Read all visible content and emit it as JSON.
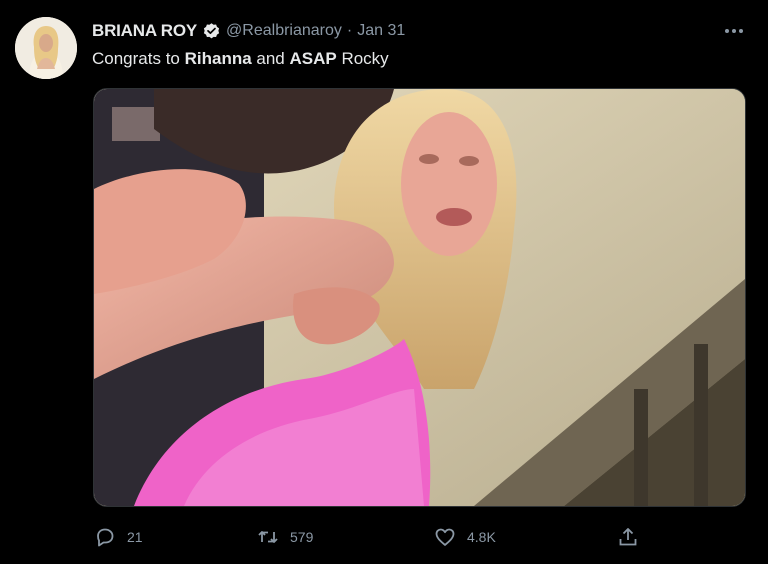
{
  "tweet": {
    "author": {
      "display_name": "BRIANA ROY",
      "handle": "@Realbrianaroy",
      "verified": true,
      "avatar_icon": "avatar-photo"
    },
    "separator": "·",
    "date": "Jan 31",
    "text_parts": {
      "prefix": "Congrats to ",
      "name1": "Rihanna",
      "middle": " and ",
      "name2": "ASAP",
      "suffix": " Rocky"
    },
    "media": {
      "description_icon": "photo-image"
    },
    "actions": {
      "replies": "21",
      "retweets": "579",
      "likes": "4.8K"
    },
    "colors": {
      "background": "#000000",
      "primary_text": "#e7e9ea",
      "secondary_text": "#8b98a5",
      "verified_badge": "#1d9bf0"
    }
  }
}
